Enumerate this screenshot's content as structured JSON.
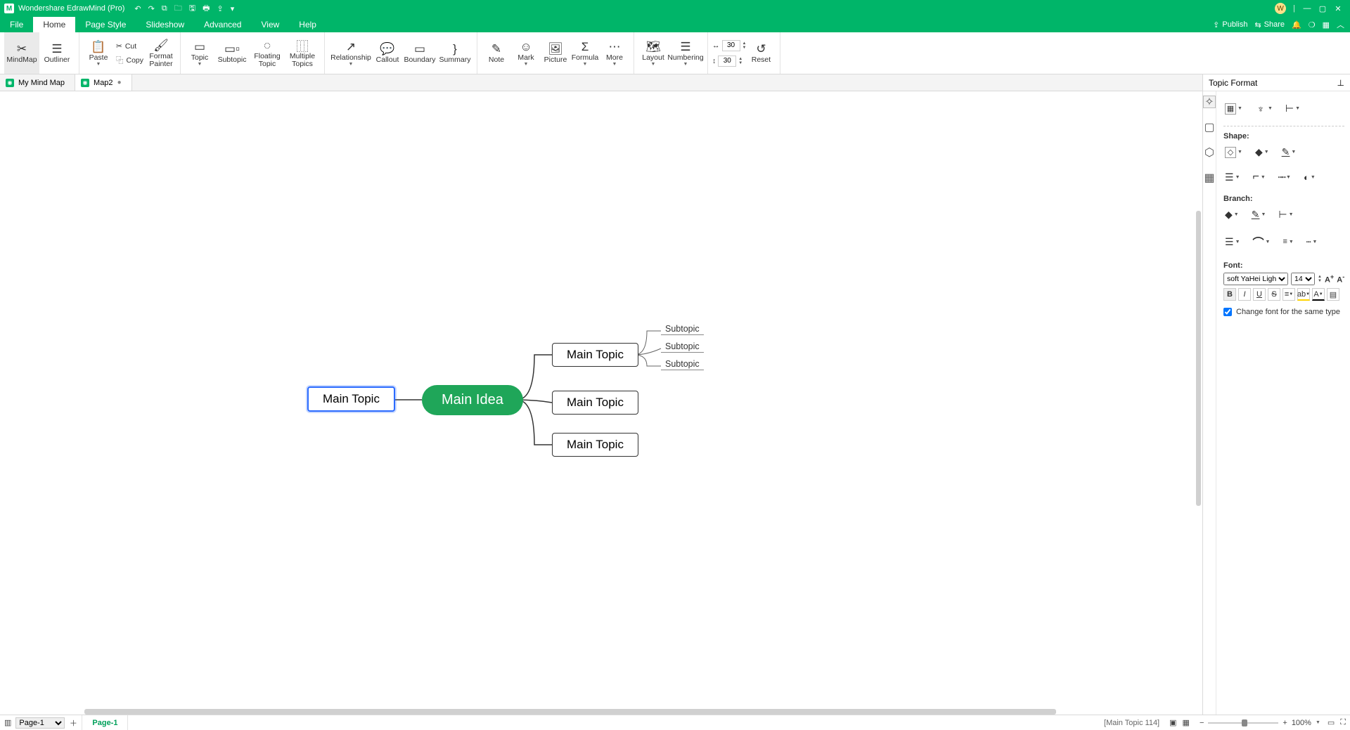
{
  "app": {
    "title": "Wondershare EdrawMind (Pro)",
    "user_initial": "W"
  },
  "qat": [
    "↶",
    "↷",
    "⧉",
    "🗀",
    "🖫",
    "🖶",
    "⇪"
  ],
  "menus": [
    "File",
    "Home",
    "Page Style",
    "Slideshow",
    "Advanced",
    "View",
    "Help"
  ],
  "active_menu": "Home",
  "menu_right": {
    "publish": "Publish",
    "share": "Share"
  },
  "ribbon": {
    "mindmap": "MindMap",
    "outliner": "Outliner",
    "paste": "Paste",
    "cut": "Cut",
    "copy": "Copy",
    "format_painter": "Format\nPainter",
    "topic": "Topic",
    "subtopic": "Subtopic",
    "floating": "Floating\nTopic",
    "multiple": "Multiple\nTopics",
    "relationship": "Relationship",
    "callout": "Callout",
    "boundary": "Boundary",
    "summary": "Summary",
    "note": "Note",
    "mark": "Mark",
    "picture": "Picture",
    "formula": "Formula",
    "more": "More",
    "layout": "Layout",
    "numbering": "Numbering",
    "width": "30",
    "height": "30",
    "reset": "Reset"
  },
  "doc_tabs": [
    {
      "label": "My Mind Map",
      "dirty": false
    },
    {
      "label": "Map2",
      "dirty": true
    }
  ],
  "active_doc_tab": 1,
  "mindmap": {
    "main_idea": "Main Idea",
    "left_topic": "Main Topic",
    "right_topics": [
      "Main Topic",
      "Main Topic",
      "Main Topic"
    ],
    "subtopics": [
      "Subtopic",
      "Subtopic",
      "Subtopic"
    ]
  },
  "right_panel": {
    "title": "Topic Format",
    "shape": "Shape:",
    "branch": "Branch:",
    "font": "Font:",
    "font_family": "soft YaHei Light",
    "font_size": "14",
    "change_same_type": "Change font for the same type"
  },
  "status": {
    "page_select": "Page-1",
    "page_tab": "Page-1",
    "selection": "[Main Topic 114]",
    "zoom": "100%"
  }
}
